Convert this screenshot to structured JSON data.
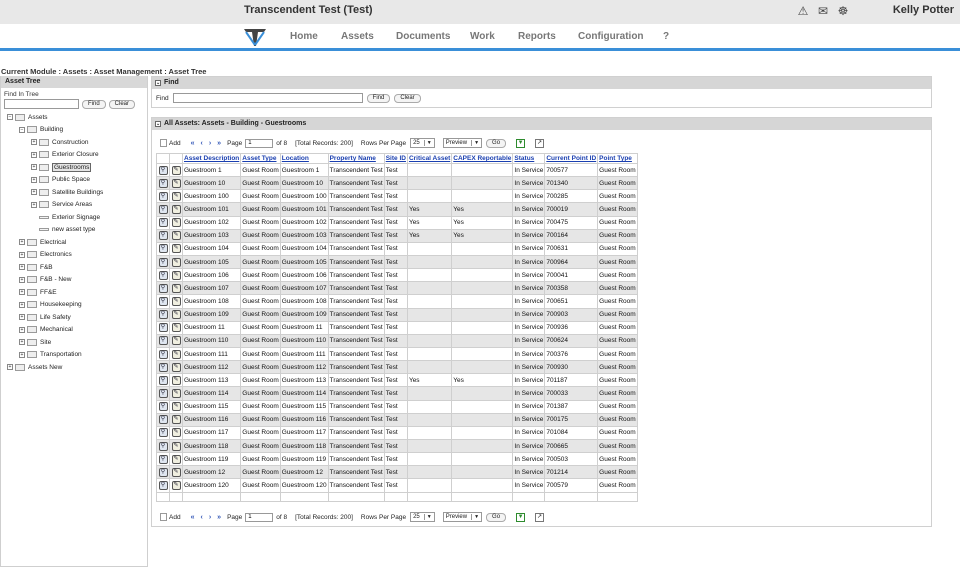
{
  "header": {
    "title": "Transcendent Test (Test)",
    "user": "Kelly Potter",
    "icons": [
      "warning-icon",
      "mail-icon",
      "chat-icon"
    ]
  },
  "nav": {
    "items": [
      "Home",
      "Assets",
      "Documents",
      "Work",
      "Reports",
      "Configuration",
      "?"
    ]
  },
  "breadcrumb": "Current Module : Assets : Asset Management : Asset Tree",
  "asset_tree": {
    "header": "Asset Tree",
    "find_label": "Find In Tree",
    "find_value": "",
    "find_button": "Find",
    "clear_button": "Clear",
    "nodes": [
      {
        "label": "Assets",
        "expander": "−"
      },
      {
        "label": "Building",
        "expander": "−"
      },
      {
        "label": "Construction",
        "expander": "+"
      },
      {
        "label": "Exterior Closure",
        "expander": "+"
      },
      {
        "label": "Guestrooms",
        "expander": "+",
        "selected": true
      },
      {
        "label": "Public Space",
        "expander": "+"
      },
      {
        "label": "Satellite Buildings",
        "expander": "+"
      },
      {
        "label": "Service Areas",
        "expander": "+"
      },
      {
        "label": "Exterior Signage",
        "expander": ""
      },
      {
        "label": "new asset type",
        "expander": ""
      },
      {
        "label": "Electrical",
        "expander": "+"
      },
      {
        "label": "Electronics",
        "expander": "+"
      },
      {
        "label": "F&B",
        "expander": "+"
      },
      {
        "label": "F&B - New",
        "expander": "+"
      },
      {
        "label": "FF&E",
        "expander": "+"
      },
      {
        "label": "Housekeeping",
        "expander": "+"
      },
      {
        "label": "Life Safety",
        "expander": "+"
      },
      {
        "label": "Mechanical",
        "expander": "+"
      },
      {
        "label": "Site",
        "expander": "+"
      },
      {
        "label": "Transportation",
        "expander": "+"
      },
      {
        "label": "Assets New",
        "expander": "+"
      }
    ]
  },
  "find_panel": {
    "header": "Find",
    "label": "Find",
    "value": "",
    "find_button": "Find",
    "clear_button": "Clear"
  },
  "assets_panel": {
    "header": "All Assets: Assets - Building - Guestrooms",
    "toolbar": {
      "add": "Add",
      "page_label": "Page",
      "page_value": "1",
      "of_pages": "of 8",
      "total_records": "[Total Records: 200]",
      "rows_per_page_label": "Rows Per Page",
      "rows_per_page": "25",
      "preview": "Preview",
      "go": "Go"
    },
    "columns": [
      "Asset Description",
      "Asset Type",
      "Location",
      "Property Name",
      "Site ID",
      "Critical Asset",
      "CAPEX Reportable",
      "Status",
      "Current Point ID",
      "Point Type"
    ],
    "rows": [
      [
        "Guestroom 1",
        "Guest Room",
        "Guestroom 1",
        "Transcendent Test",
        "Test",
        "",
        "",
        "In Service",
        "700577",
        "Guest Room"
      ],
      [
        "Guestroom 10",
        "Guest Room",
        "Guestroom 10",
        "Transcendent Test",
        "Test",
        "",
        "",
        "In Service",
        "701340",
        "Guest Room"
      ],
      [
        "Guestroom 100",
        "Guest Room",
        "Guestroom 100",
        "Transcendent Test",
        "Test",
        "",
        "",
        "In Service",
        "700285",
        "Guest Room"
      ],
      [
        "Guestroom 101",
        "Guest Room",
        "Guestroom 101",
        "Transcendent Test",
        "Test",
        "Yes",
        "Yes",
        "In Service",
        "700019",
        "Guest Room"
      ],
      [
        "Guestroom 102",
        "Guest Room",
        "Guestroom 102",
        "Transcendent Test",
        "Test",
        "Yes",
        "Yes",
        "In Service",
        "700475",
        "Guest Room"
      ],
      [
        "Guestroom 103",
        "Guest Room",
        "Guestroom 103",
        "Transcendent Test",
        "Test",
        "Yes",
        "Yes",
        "In Service",
        "700164",
        "Guest Room"
      ],
      [
        "Guestroom 104",
        "Guest Room",
        "Guestroom 104",
        "Transcendent Test",
        "Test",
        "",
        "",
        "In Service",
        "700631",
        "Guest Room"
      ],
      [
        "Guestroom 105",
        "Guest Room",
        "Guestroom 105",
        "Transcendent Test",
        "Test",
        "",
        "",
        "In Service",
        "700964",
        "Guest Room"
      ],
      [
        "Guestroom 106",
        "Guest Room",
        "Guestroom 106",
        "Transcendent Test",
        "Test",
        "",
        "",
        "In Service",
        "700041",
        "Guest Room"
      ],
      [
        "Guestroom 107",
        "Guest Room",
        "Guestroom 107",
        "Transcendent Test",
        "Test",
        "",
        "",
        "In Service",
        "700358",
        "Guest Room"
      ],
      [
        "Guestroom 108",
        "Guest Room",
        "Guestroom 108",
        "Transcendent Test",
        "Test",
        "",
        "",
        "In Service",
        "700651",
        "Guest Room"
      ],
      [
        "Guestroom 109",
        "Guest Room",
        "Guestroom 109",
        "Transcendent Test",
        "Test",
        "",
        "",
        "In Service",
        "700903",
        "Guest Room"
      ],
      [
        "Guestroom 11",
        "Guest Room",
        "Guestroom 11",
        "Transcendent Test",
        "Test",
        "",
        "",
        "In Service",
        "700936",
        "Guest Room"
      ],
      [
        "Guestroom 110",
        "Guest Room",
        "Guestroom 110",
        "Transcendent Test",
        "Test",
        "",
        "",
        "In Service",
        "700624",
        "Guest Room"
      ],
      [
        "Guestroom 111",
        "Guest Room",
        "Guestroom 111",
        "Transcendent Test",
        "Test",
        "",
        "",
        "In Service",
        "700376",
        "Guest Room"
      ],
      [
        "Guestroom 112",
        "Guest Room",
        "Guestroom 112",
        "Transcendent Test",
        "Test",
        "",
        "",
        "In Service",
        "700930",
        "Guest Room"
      ],
      [
        "Guestroom 113",
        "Guest Room",
        "Guestroom 113",
        "Transcendent Test",
        "Test",
        "Yes",
        "Yes",
        "In Service",
        "701187",
        "Guest Room"
      ],
      [
        "Guestroom 114",
        "Guest Room",
        "Guestroom 114",
        "Transcendent Test",
        "Test",
        "",
        "",
        "In Service",
        "700033",
        "Guest Room"
      ],
      [
        "Guestroom 115",
        "Guest Room",
        "Guestroom 115",
        "Transcendent Test",
        "Test",
        "",
        "",
        "In Service",
        "701387",
        "Guest Room"
      ],
      [
        "Guestroom 116",
        "Guest Room",
        "Guestroom 116",
        "Transcendent Test",
        "Test",
        "",
        "",
        "In Service",
        "700175",
        "Guest Room"
      ],
      [
        "Guestroom 117",
        "Guest Room",
        "Guestroom 117",
        "Transcendent Test",
        "Test",
        "",
        "",
        "In Service",
        "701084",
        "Guest Room"
      ],
      [
        "Guestroom 118",
        "Guest Room",
        "Guestroom 118",
        "Transcendent Test",
        "Test",
        "",
        "",
        "In Service",
        "700665",
        "Guest Room"
      ],
      [
        "Guestroom 119",
        "Guest Room",
        "Guestroom 119",
        "Transcendent Test",
        "Test",
        "",
        "",
        "In Service",
        "700503",
        "Guest Room"
      ],
      [
        "Guestroom 12",
        "Guest Room",
        "Guestroom 12",
        "Transcendent Test",
        "Test",
        "",
        "",
        "In Service",
        "701214",
        "Guest Room"
      ],
      [
        "Guestroom 120",
        "Guest Room",
        "Guestroom 120",
        "Transcendent Test",
        "Test",
        "",
        "",
        "In Service",
        "700579",
        "Guest Room"
      ]
    ]
  },
  "colors": {
    "accent": "#3a8fd8",
    "link": "#1a3fb0",
    "header_bg": "#e8e8e8"
  }
}
